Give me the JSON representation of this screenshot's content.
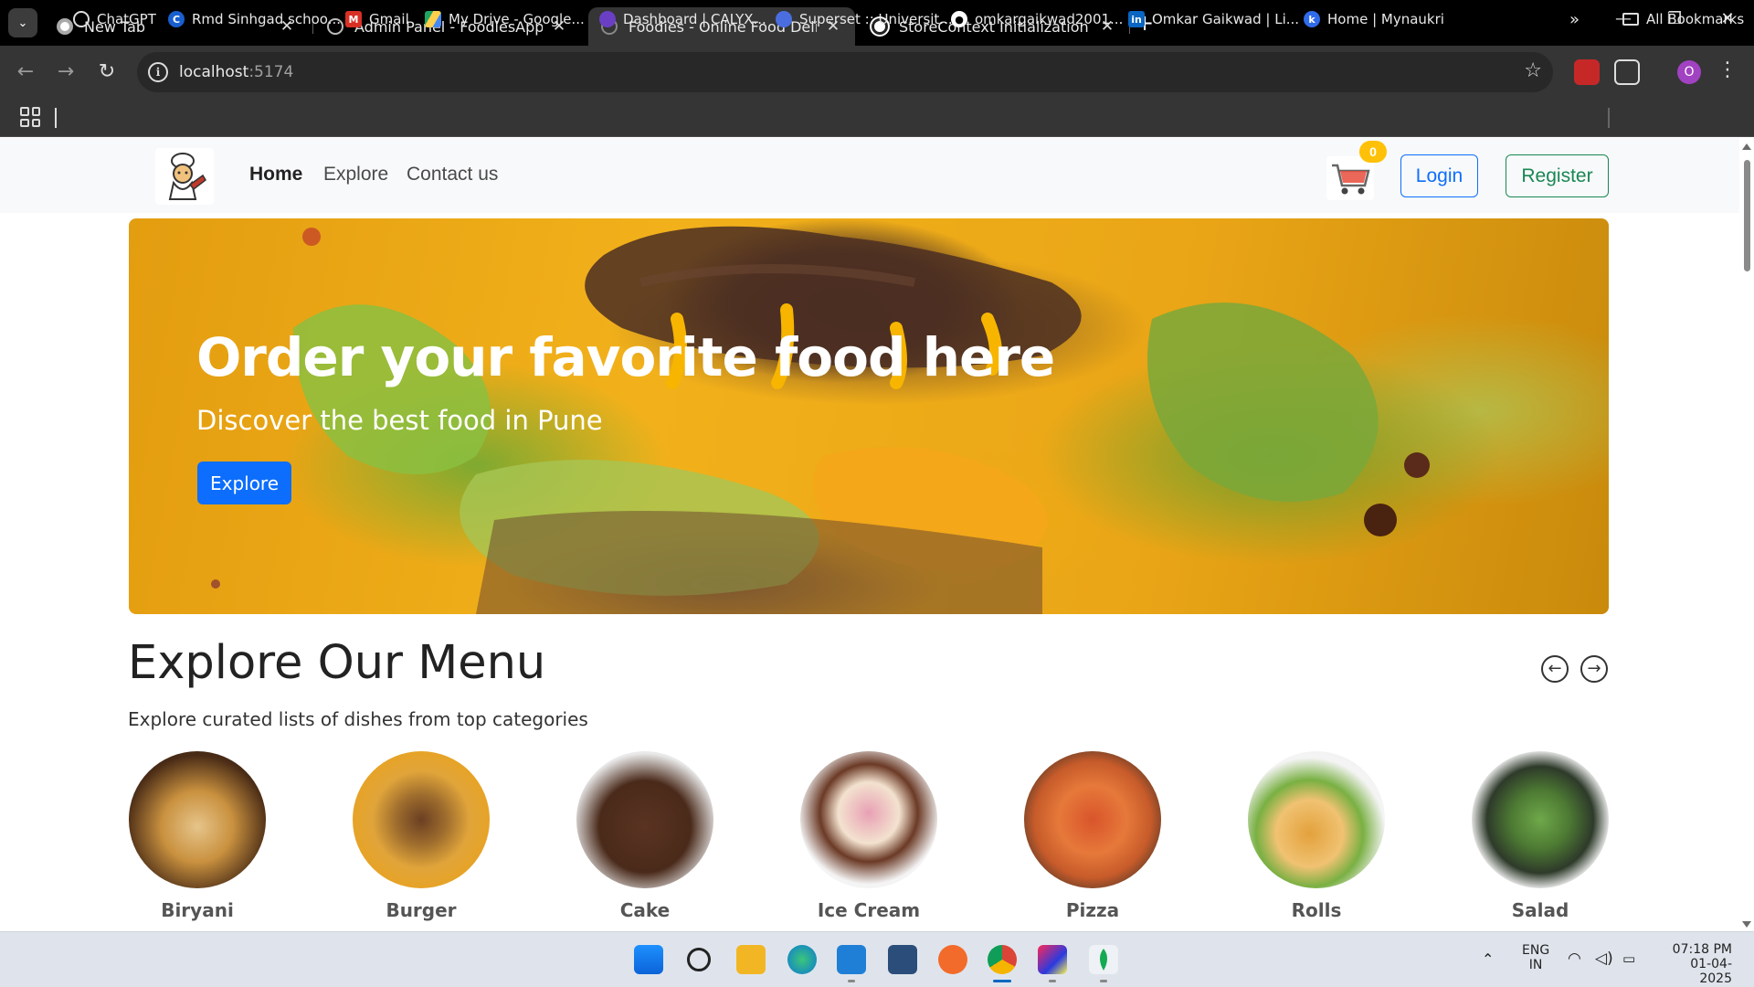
{
  "browser": {
    "tabs": [
      {
        "title": "New Tab",
        "active": false
      },
      {
        "title": "Admin Panel - FoodiesApp",
        "active": false
      },
      {
        "title": "Foodies - Online Food Delivery",
        "active": true
      },
      {
        "title": "StoreContext Initialization Issue",
        "active": false
      }
    ],
    "url_host": "localhost",
    "url_port": ":5174",
    "profile_initial": "O",
    "bookmarks": [
      "ChatGPT",
      "Rmd Sinhgad schoo...",
      "Gmail",
      "My Drive - Google...",
      "Dashboard | CALYX...",
      "Superset :: Universit...",
      "omkargaikwad2001...",
      "Omkar Gaikwad | Li...",
      "Home | Mynaukri"
    ],
    "all_bookmarks": "All Bookmarks"
  },
  "site": {
    "nav": {
      "links": [
        "Home",
        "Explore",
        "Contact us"
      ],
      "active": "Home",
      "cart_count": "0",
      "login": "Login",
      "register": "Register"
    },
    "hero": {
      "title": "Order your favorite food here",
      "subtitle": "Discover the best food in Pune",
      "button": "Explore"
    },
    "menu": {
      "title": "Explore Our Menu",
      "subtitle": "Explore curated lists of dishes from top categories",
      "categories": [
        "Biryani",
        "Burger",
        "Cake",
        "Ice Cream",
        "Pizza",
        "Rolls",
        "Salad"
      ]
    }
  },
  "taskbar": {
    "lang_line1": "ENG",
    "lang_line2": "IN",
    "time": "07:18 PM",
    "date": "01-04-2025"
  },
  "colors": {
    "primary": "#0d6efd",
    "success": "#198754",
    "badge": "#ffc107",
    "hero_orange": "#f2b11b"
  }
}
